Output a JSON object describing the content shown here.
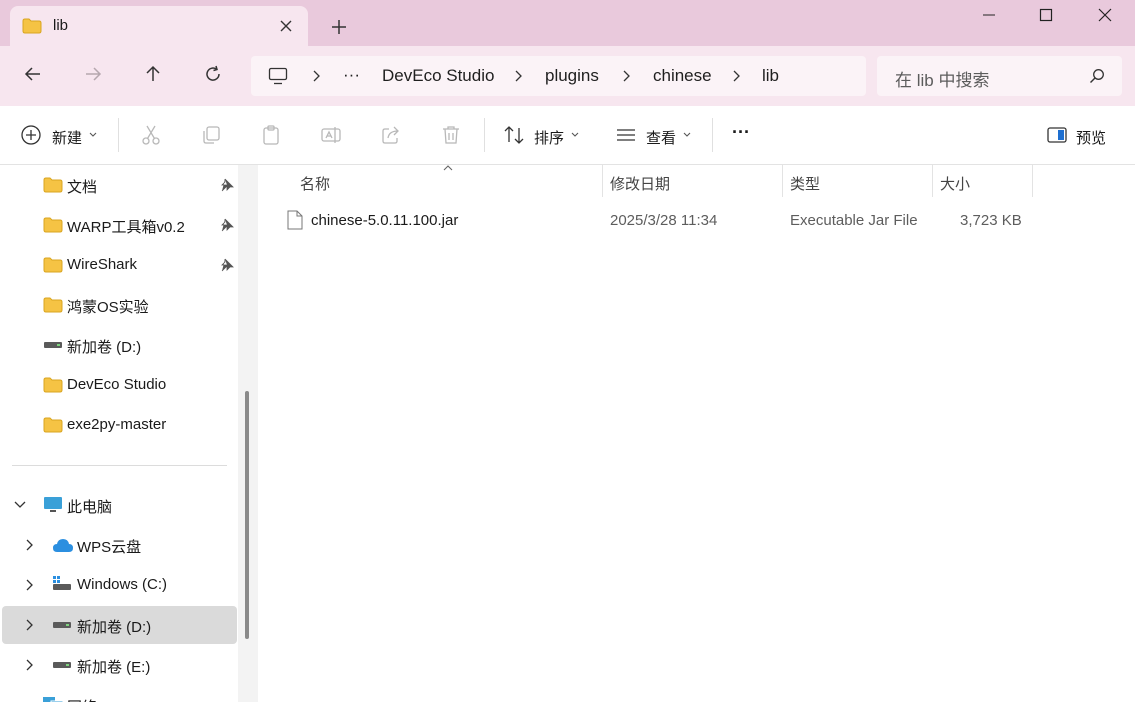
{
  "window": {
    "tab_title": "lib",
    "minimize": "minimize-icon",
    "maximize": "maximize-icon",
    "close": "close-icon"
  },
  "nav": {
    "breadcrumb": [
      "DevEco Studio",
      "plugins",
      "chinese",
      "lib"
    ],
    "overflow": "···",
    "search_placeholder": "在 lib 中搜索"
  },
  "toolbar": {
    "new_label": "新建",
    "sort_label": "排序",
    "view_label": "查看",
    "more": "···",
    "preview_label": "预览"
  },
  "sidebar": {
    "quick_access": [
      {
        "label": "文档",
        "icon": "folder-icon",
        "pinned": true
      },
      {
        "label": "WARP工具箱v0.2",
        "icon": "folder-icon",
        "pinned": true
      },
      {
        "label": "WireShark",
        "icon": "folder-icon",
        "pinned": true
      },
      {
        "label": "鸿蒙OS实验",
        "icon": "folder-icon",
        "pinned": false
      },
      {
        "label": "新加卷 (D:)",
        "icon": "drive-icon",
        "pinned": false
      },
      {
        "label": "DevEco Studio",
        "icon": "folder-icon",
        "pinned": false
      },
      {
        "label": "exe2py-master",
        "icon": "folder-icon",
        "pinned": false
      }
    ],
    "this_pc": {
      "label": "此电脑",
      "expanded": true
    },
    "drives": [
      {
        "label": "WPS云盘",
        "icon": "cloud-icon",
        "selected": false
      },
      {
        "label": "Windows  (C:)",
        "icon": "windows-drive-icon",
        "selected": false
      },
      {
        "label": "新加卷 (D:)",
        "icon": "drive-icon",
        "selected": true
      },
      {
        "label": "新加卷 (E:)",
        "icon": "drive-icon",
        "selected": false
      }
    ],
    "cut_off_label": "网络"
  },
  "file_list": {
    "columns": [
      "名称",
      "修改日期",
      "类型",
      "大小"
    ],
    "rows": [
      {
        "name": "chinese-5.0.11.100.jar",
        "modified": "2025/3/28 11:34",
        "type": "Executable Jar File",
        "size": "3,723 KB"
      }
    ]
  },
  "colors": {
    "title_bar": "#e9c9dc",
    "nav_bar": "#f7e6ef",
    "folder": "#f5c344",
    "selection": "#dadada"
  }
}
